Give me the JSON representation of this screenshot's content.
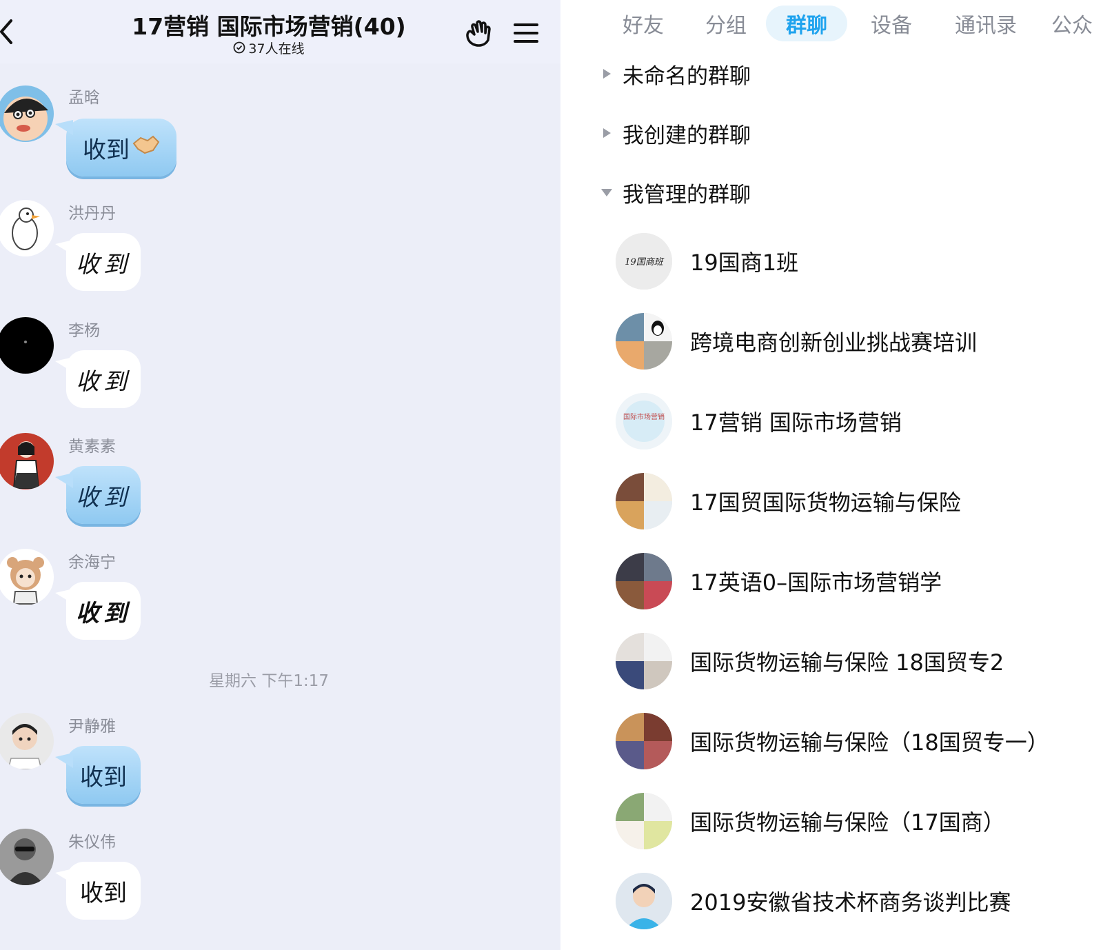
{
  "chat": {
    "title": "17营销 国际市场营销(40)",
    "online": "37人在线",
    "messages": [
      {
        "sender": "孟晗",
        "text": "收到",
        "style": "blue"
      },
      {
        "sender": "洪丹丹",
        "text": "收到",
        "style": "white"
      },
      {
        "sender": "李杨",
        "text": "收到",
        "style": "white"
      },
      {
        "sender": "黄素素",
        "text": "收到",
        "style": "blue"
      },
      {
        "sender": "余海宁",
        "text": "收到",
        "style": "white"
      },
      {
        "sender": "尹静雅",
        "text": "收到",
        "style": "blue"
      },
      {
        "sender": "朱仪伟",
        "text": "收到",
        "style": "white"
      }
    ],
    "timestamp": "星期六 下午1:17"
  },
  "contacts": {
    "tabs": [
      "好友",
      "分组",
      "群聊",
      "设备",
      "通讯录",
      "公众"
    ],
    "active_tab": "群聊",
    "sections": [
      {
        "label": "未命名的群聊",
        "expanded": false
      },
      {
        "label": "我创建的群聊",
        "expanded": false
      },
      {
        "label": "我管理的群聊",
        "expanded": true
      }
    ],
    "groups": [
      {
        "name": "19国商1班",
        "avatar_text": "19国商班"
      },
      {
        "name": "跨境电商创新创业挑战赛培训"
      },
      {
        "name": "17营销 国际市场营销",
        "avatar_text": "国际市场营销"
      },
      {
        "name": "17国贸国际货物运输与保险"
      },
      {
        "name": "17英语0–国际市场营销学"
      },
      {
        "name": "国际货物运输与保险 18国贸专2"
      },
      {
        "name": "国际货物运输与保险（18国贸专一）"
      },
      {
        "name": "国际货物运输与保险（17国商）"
      },
      {
        "name": "2019安徽省技术杯商务谈判比赛"
      }
    ]
  },
  "colors": {
    "accent": "#1fa3ee",
    "chat_bg": "#eceef8",
    "bubble_blue": "#9dd0f4"
  }
}
